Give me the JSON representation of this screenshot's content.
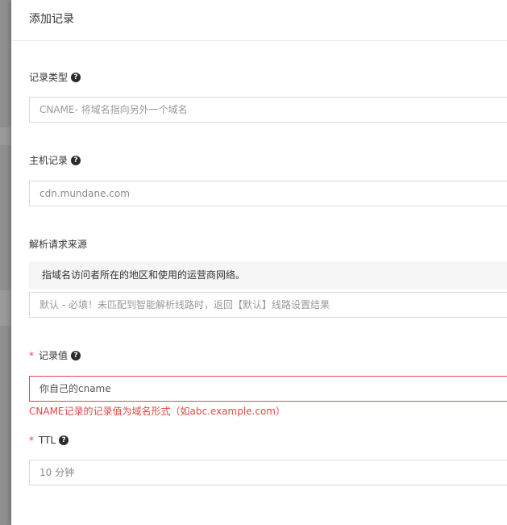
{
  "panel": {
    "title": "添加记录"
  },
  "record_type": {
    "label": "记录类型",
    "value": "CNAME- 将域名指向另外一个域名"
  },
  "host": {
    "label": "主机记录",
    "value": "cdn.mundane.com"
  },
  "source": {
    "label": "解析请求来源",
    "info": "指域名访问者所在的地区和使用的运营商网络。",
    "placeholder": "默认 - 必填！未匹配到智能解析线路时，返回【默认】线路设置结果"
  },
  "record_value": {
    "required_mark": "*",
    "label": "记录值",
    "value": "你自己的cname",
    "error": "CNAME记录的记录值为域名形式（如abc.example.com）"
  },
  "ttl": {
    "required_mark": "*",
    "label": "TTL",
    "value": "10 分钟"
  },
  "help_glyph": "?",
  "colors": {
    "error": "#e54545",
    "border": "#d9d9d9",
    "info_bg": "#f5f5f5"
  }
}
